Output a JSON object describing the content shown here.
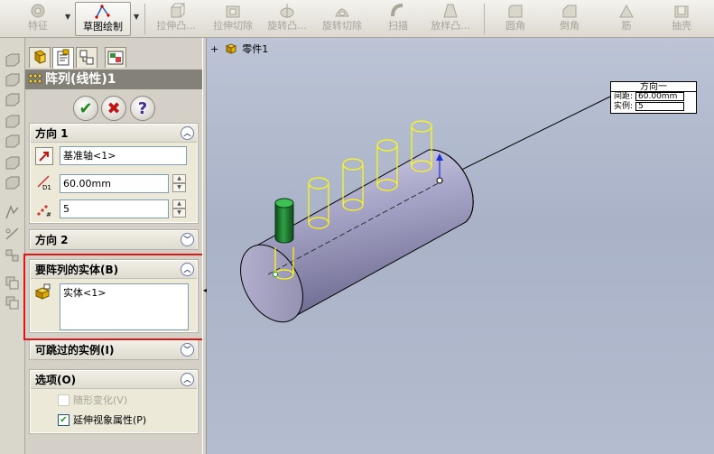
{
  "toolbar": {
    "items": [
      {
        "label": "特征",
        "icon": "feature-icon",
        "state": "disabled"
      },
      {
        "label": "草图绘制",
        "icon": "sketch-icon",
        "state": "active"
      },
      {
        "label": "拉伸凸...",
        "icon": "extrude-boss-icon",
        "state": "disabled"
      },
      {
        "label": "拉伸切除",
        "icon": "extrude-cut-icon",
        "state": "disabled"
      },
      {
        "label": "旋转凸...",
        "icon": "revolve-boss-icon",
        "state": "disabled"
      },
      {
        "label": "旋转切除",
        "icon": "revolve-cut-icon",
        "state": "disabled"
      },
      {
        "label": "扫描",
        "icon": "sweep-icon",
        "state": "disabled"
      },
      {
        "label": "放样凸...",
        "icon": "loft-icon",
        "state": "disabled"
      },
      {
        "label": "圆角",
        "icon": "fillet-icon",
        "state": "disabled"
      },
      {
        "label": "倒角",
        "icon": "chamfer-icon",
        "state": "disabled"
      },
      {
        "label": "筋",
        "icon": "rib-icon",
        "state": "disabled"
      },
      {
        "label": "抽壳",
        "icon": "shell-icon",
        "state": "disabled"
      }
    ]
  },
  "property_manager": {
    "title": "阵列(线性)1",
    "buttons": {
      "ok": "✔",
      "cancel": "✖",
      "help": "?"
    },
    "direction1": {
      "header": "方向 1",
      "reference": "基准轴<1>",
      "spacing": "60.00mm",
      "instances": "5"
    },
    "direction2": {
      "header": "方向 2"
    },
    "bodies": {
      "header": "要阵列的实体(B)",
      "items": [
        "实体<1>"
      ]
    },
    "skip": {
      "header": "可跳过的实例(I)"
    },
    "options": {
      "header": "选项(O)",
      "vary_sketch": {
        "label": "随形变化(V)",
        "checked": false,
        "enabled": false
      },
      "propagate": {
        "label": "延伸视象属性(P)",
        "checked": true,
        "enabled": true
      }
    }
  },
  "viewport": {
    "tree_root": "零件1",
    "callout": {
      "title": "方向一",
      "spacing_label": "间距:",
      "spacing_value": "60.00mm",
      "instances_label": "实例:",
      "instances_value": "5"
    }
  },
  "colors": {
    "highlight": "#e01515",
    "body": "#9a98b8",
    "preview": "#ffff00",
    "seed": "#1f7a2c"
  }
}
